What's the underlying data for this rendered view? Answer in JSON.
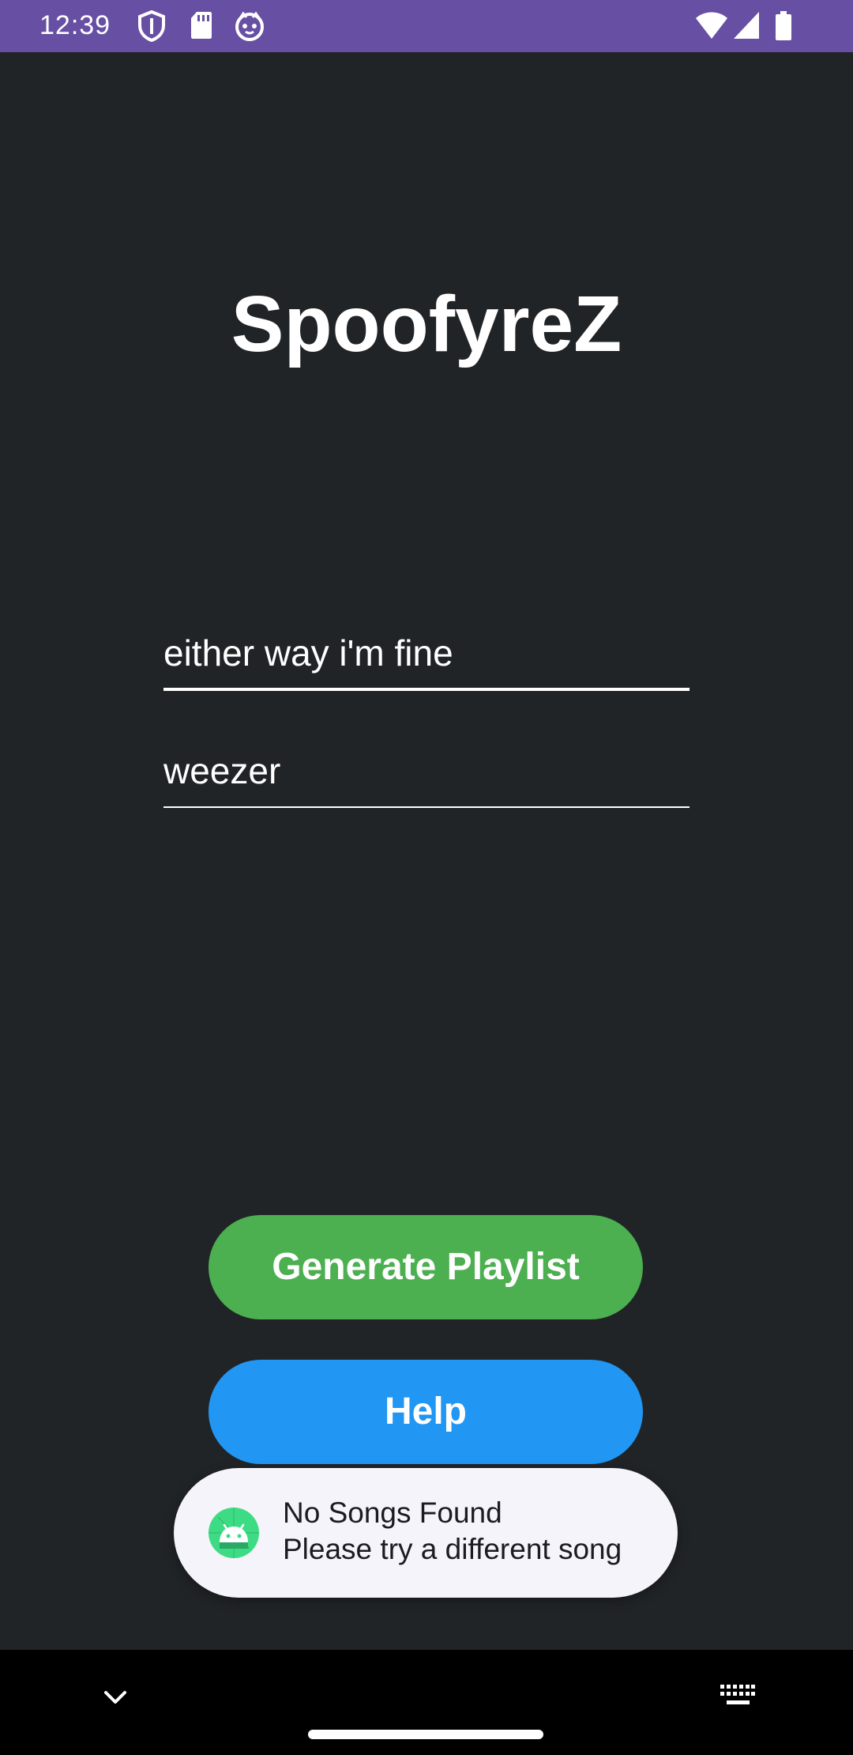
{
  "status_bar": {
    "time": "12:39",
    "icons_left": [
      "shield-icon",
      "sd-card-icon",
      "cat-face-icon"
    ],
    "icons_right": [
      "wifi-icon",
      "cellular-signal-icon",
      "battery-icon"
    ],
    "color": "#6750a4"
  },
  "app": {
    "title": "SpoofyreZ"
  },
  "form": {
    "song_value": "either way i'm fine",
    "artist_value": "weezer"
  },
  "buttons": {
    "generate_label": "Generate Playlist",
    "generate_color": "#4caf50",
    "help_label": "Help",
    "help_color": "#2196f3"
  },
  "toast": {
    "icon": "android-icon",
    "line1": "No Songs Found",
    "line2": "Please try a different song"
  },
  "nav_bar": {
    "icons": [
      "chevron-down-icon",
      "home-handle",
      "keyboard-icon"
    ]
  }
}
